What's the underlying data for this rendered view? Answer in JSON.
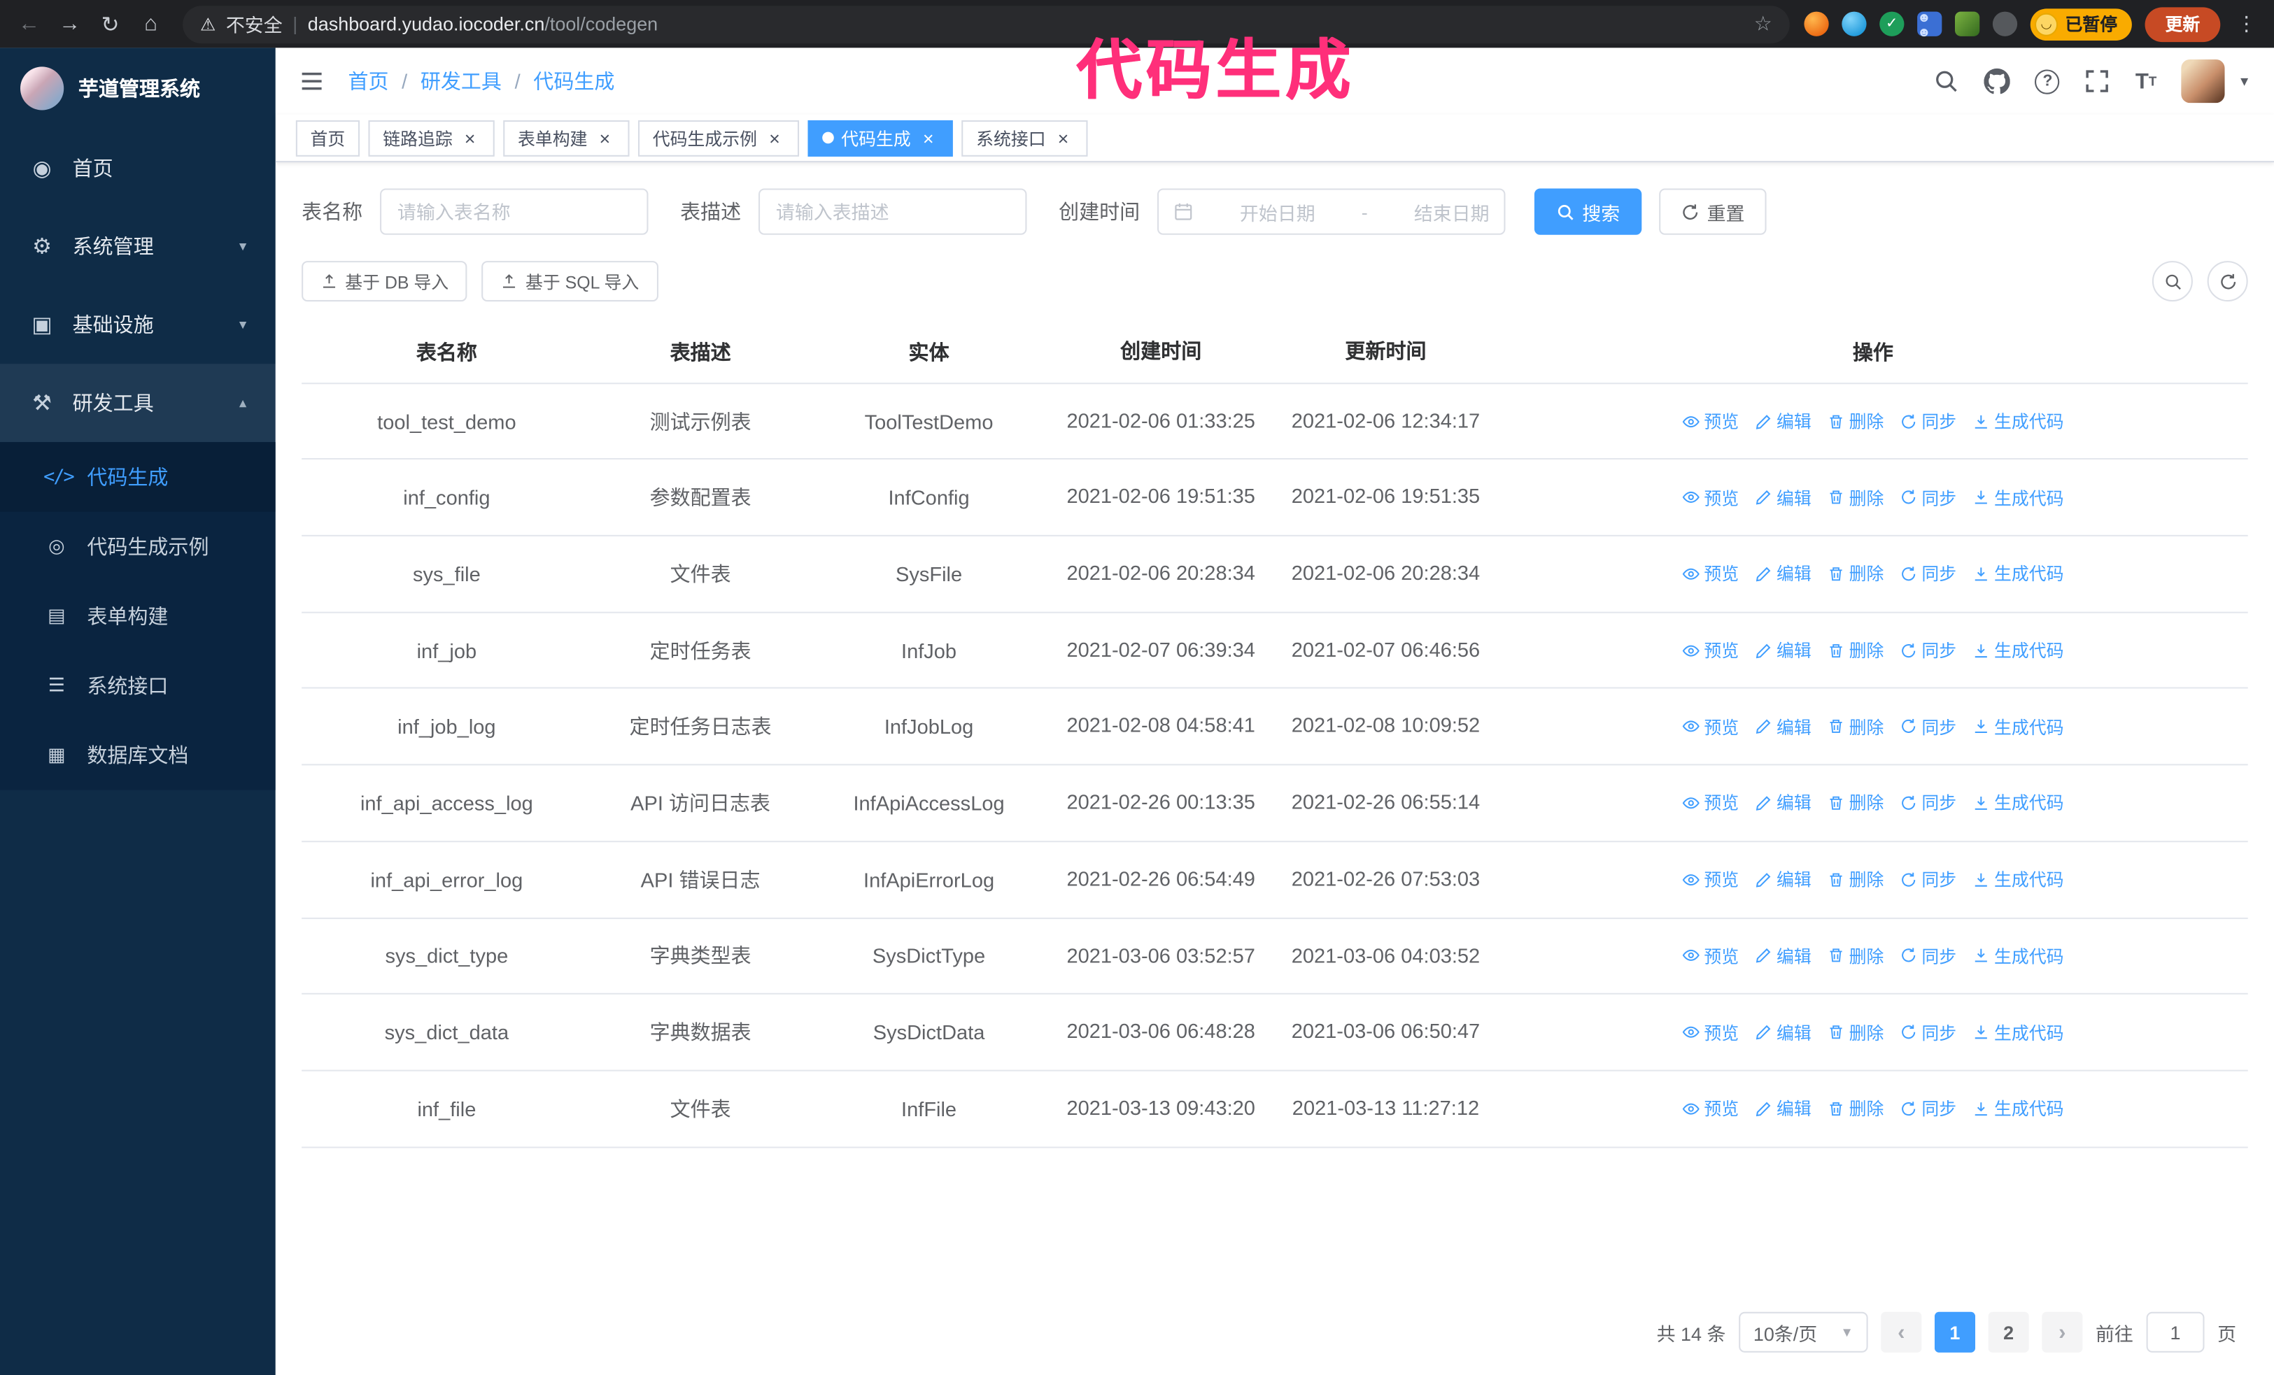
{
  "browser": {
    "security_label": "不安全",
    "url_host": "dashboard.yudao.iocoder.cn",
    "url_path": "/tool/codegen",
    "paused_badge": "已暂停",
    "update_button": "更新"
  },
  "annotation": {
    "text": "代码生成"
  },
  "colors": {
    "accent": "#409eff",
    "annotation_pink": "#ff2f7a",
    "sidebar_bg": "#0f2c47",
    "submenu_bg": "#0a2440",
    "update_button": "#c74a24",
    "paused_badge": "#f9ab00"
  },
  "sidebar": {
    "logo_title": "芋道管理系统",
    "items": [
      {
        "label": "首页"
      },
      {
        "label": "系统管理"
      },
      {
        "label": "基础设施"
      },
      {
        "label": "研发工具"
      }
    ],
    "sub_items": [
      {
        "label": "代码生成"
      },
      {
        "label": "代码生成示例"
      },
      {
        "label": "表单构建"
      },
      {
        "label": "系统接口"
      },
      {
        "label": "数据库文档"
      }
    ]
  },
  "header": {
    "breadcrumb": [
      "首页",
      "研发工具",
      "代码生成"
    ]
  },
  "tabs": [
    "首页",
    "链路追踪",
    "表单构建",
    "代码生成示例",
    "代码生成",
    "系统接口"
  ],
  "filters": {
    "table_name_label": "表名称",
    "table_name_placeholder": "请输入表名称",
    "table_desc_label": "表描述",
    "table_desc_placeholder": "请输入表描述",
    "create_time_label": "创建时间",
    "date_start_placeholder": "开始日期",
    "date_separator": "-",
    "date_end_placeholder": "结束日期",
    "search_button": "搜索",
    "reset_button": "重置"
  },
  "toolbar": {
    "import_db_label": "基于 DB 导入",
    "import_sql_label": "基于 SQL 导入"
  },
  "table": {
    "columns": [
      "表名称",
      "表描述",
      "实体",
      "创建时间",
      "更新时间",
      "操作"
    ],
    "actions": [
      "预览",
      "编辑",
      "删除",
      "同步",
      "生成代码"
    ],
    "rows": [
      {
        "name": "tool_test_demo",
        "desc": "测试示例表",
        "entity": "ToolTestDemo",
        "created": "2021-02-06 01:33:25",
        "updated": "2021-02-06 12:34:17"
      },
      {
        "name": "inf_config",
        "desc": "参数配置表",
        "entity": "InfConfig",
        "created": "2021-02-06 19:51:35",
        "updated": "2021-02-06 19:51:35"
      },
      {
        "name": "sys_file",
        "desc": "文件表",
        "entity": "SysFile",
        "created": "2021-02-06 20:28:34",
        "updated": "2021-02-06 20:28:34"
      },
      {
        "name": "inf_job",
        "desc": "定时任务表",
        "entity": "InfJob",
        "created": "2021-02-07 06:39:34",
        "updated": "2021-02-07 06:46:56"
      },
      {
        "name": "inf_job_log",
        "desc": "定时任务日志表",
        "entity": "InfJobLog",
        "created": "2021-02-08 04:58:41",
        "updated": "2021-02-08 10:09:52"
      },
      {
        "name": "inf_api_access_log",
        "desc": "API 访问日志表",
        "entity": "InfApiAccessLog",
        "created": "2021-02-26 00:13:35",
        "updated": "2021-02-26 06:55:14"
      },
      {
        "name": "inf_api_error_log",
        "desc": "API 错误日志",
        "entity": "InfApiErrorLog",
        "created": "2021-02-26 06:54:49",
        "updated": "2021-02-26 07:53:03"
      },
      {
        "name": "sys_dict_type",
        "desc": "字典类型表",
        "entity": "SysDictType",
        "created": "2021-03-06 03:52:57",
        "updated": "2021-03-06 04:03:52"
      },
      {
        "name": "sys_dict_data",
        "desc": "字典数据表",
        "entity": "SysDictData",
        "created": "2021-03-06 06:48:28",
        "updated": "2021-03-06 06:50:47"
      },
      {
        "name": "inf_file",
        "desc": "文件表",
        "entity": "InfFile",
        "created": "2021-03-13 09:43:20",
        "updated": "2021-03-13 11:27:12"
      }
    ]
  },
  "pagination": {
    "total_label": "共 14 条",
    "page_size": "10条/页",
    "pages": [
      "1",
      "2"
    ],
    "goto_prefix": "前往",
    "goto_value": "1",
    "goto_suffix": "页"
  }
}
